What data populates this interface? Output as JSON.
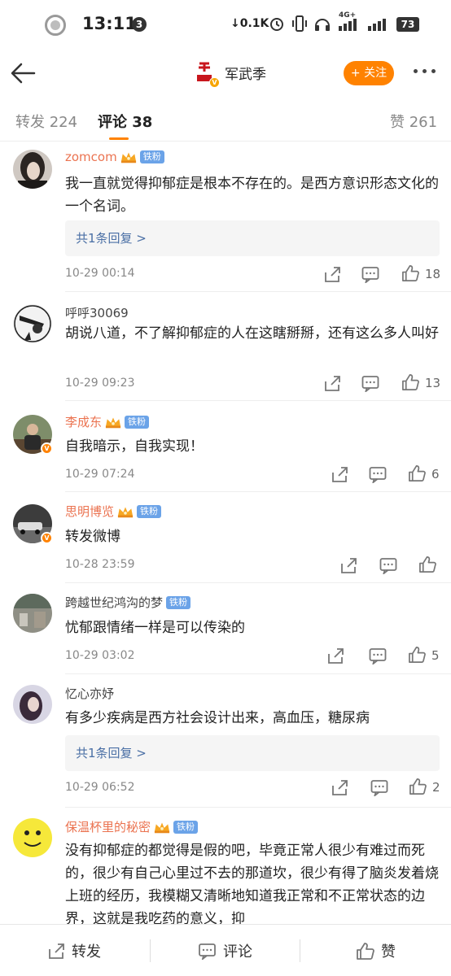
{
  "status_bar": {
    "time": "13:11",
    "notification_count": "3",
    "net_speed": "0.1K",
    "signal_label": "4G+",
    "battery": "73"
  },
  "header": {
    "account_name": "军武季",
    "follow_label": "+ 关注"
  },
  "tabs": [
    {
      "label": "转发 224"
    },
    {
      "label": "评论 38"
    },
    {
      "label": "赞 261"
    }
  ],
  "comments": [
    {
      "user": "zomcom",
      "fan_badge": "铁粉",
      "text": "我一直就觉得抑郁症是根本不存在的。是西方意识形态文化的一个名词。",
      "reply_link": "共1条回复 >",
      "time": "10-29 00:14",
      "likes": "18"
    },
    {
      "user": "呼呼30069",
      "text": "胡说八道，不了解抑郁症的人在这瞎掰掰，还有这么多人叫好",
      "time": "10-29 09:23",
      "likes": "13"
    },
    {
      "user": "李成东",
      "fan_badge": "铁粉",
      "text": "自我暗示，自我实现！",
      "time": "10-29 07:24",
      "likes": "6"
    },
    {
      "user": "思明博览",
      "fan_badge": "铁粉",
      "text": "转发微博",
      "time": "10-28 23:59",
      "likes": ""
    },
    {
      "user": "跨越世纪鸿沟的梦",
      "fan_badge": "铁粉",
      "text": "忧郁跟情绪一样是可以传染的",
      "time": "10-29 03:02",
      "likes": "5"
    },
    {
      "user": "忆心亦妤",
      "text": "有多少疾病是西方社会设计出来，高血压，糖尿病",
      "reply_link": "共1条回复 >",
      "time": "10-29 06:52",
      "likes": "2"
    },
    {
      "user": "保温杯里的秘密",
      "fan_badge": "铁粉",
      "text": "没有抑郁症的都觉得是假的吧，毕竟正常人很少有难过而死的，很少有自己心里过不去的那道坎，很少有得了脑炎发着烧上班的经历，我模糊又清晰地知道我正常和不正常状态的边界，这就是我吃药的意义，抑"
    }
  ],
  "bottom_bar": {
    "repost_label": "转发",
    "comment_label": "评论",
    "like_label": "赞"
  },
  "colors": {
    "accent": "#ff8200",
    "vip_name": "#eb7350",
    "fan_tag": "#6ba3e8",
    "reply_link": "#4a6fa5"
  }
}
